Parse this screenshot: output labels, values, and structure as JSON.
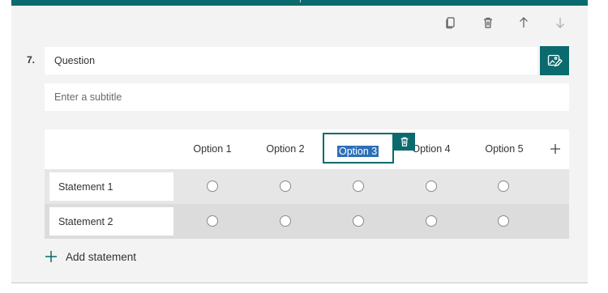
{
  "toolbar": {
    "copy_icon": "copy-icon",
    "delete_icon": "trash-icon",
    "move_up_icon": "arrow-up-icon",
    "move_down_icon": "arrow-down-icon"
  },
  "question": {
    "number": "7.",
    "text": "Question",
    "subtitle_placeholder": "Enter a subtitle"
  },
  "likert": {
    "options": [
      "Option 1",
      "Option 2",
      "Option 3",
      "Option 4",
      "Option 5"
    ],
    "editing_option": "Option 3",
    "statements": [
      "Statement 1",
      "Statement 2"
    ]
  },
  "add_statement_label": "Add statement",
  "colors": {
    "accent": "#0b6a6e",
    "selection": "#2d6fb8"
  }
}
